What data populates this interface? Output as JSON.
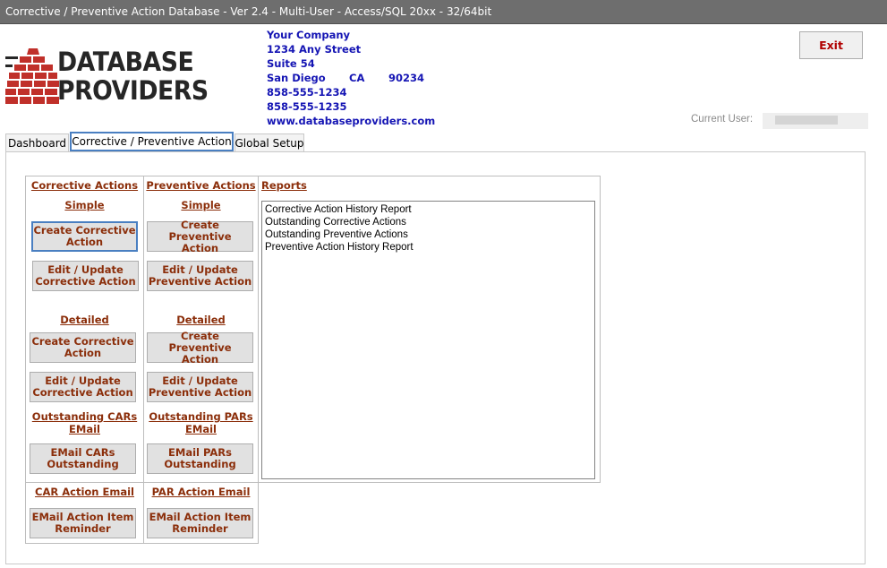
{
  "window": {
    "title": "Corrective / Preventive Action Database - Ver 2.4  - Multi-User - Access/SQL 20xx - 32/64bit"
  },
  "logo": {
    "line1": "DATABASE",
    "line2": "PROVIDERS"
  },
  "company": {
    "name": "Your Company",
    "street": "1234 Any Street",
    "suite": "Suite 54",
    "city": "San Diego",
    "state": "CA",
    "zip": "90234",
    "phone1": "858-555-1234",
    "phone2": "858-555-1235",
    "website": "www.databaseproviders.com"
  },
  "header": {
    "exit_label": "Exit",
    "current_user_label": "Current User:"
  },
  "tabs": [
    {
      "label": "Dashboard"
    },
    {
      "label": "Corrective / Preventive Action"
    },
    {
      "label": "Global Setup"
    }
  ],
  "corrective": {
    "title": "Corrective Actions",
    "simple": "Simple",
    "create_simple": "Create Corrective\nAction",
    "edit_simple": "Edit / Update\nCorrective Action",
    "detailed": "Detailed",
    "create_detailed": "Create Corrective\nAction",
    "edit_detailed": "Edit / Update\nCorrective Action",
    "outstanding_email": "Outstanding CARs\nEMail",
    "email_outstanding": "EMail CARs\nOutstanding",
    "action_email": "CAR Action Email",
    "email_reminder": "EMail Action Item\nReminder"
  },
  "preventive": {
    "title": "Preventive Actions",
    "simple": "Simple",
    "create_simple": "Create Preventive\nAction",
    "edit_simple": "Edit / Update\nPreventive Action",
    "detailed": "Detailed",
    "create_detailed": "Create Preventive\nAction",
    "edit_detailed": "Edit / Update\nPreventive Action",
    "outstanding_email": "Outstanding PARs\nEMail",
    "email_outstanding": "EMail PARs\nOutstanding",
    "action_email": "PAR Action Email",
    "email_reminder": "EMail Action Item\nReminder"
  },
  "reports": {
    "title": "Reports",
    "items": [
      "Corrective Action History Report",
      "Outstanding Corrective Actions",
      "Outstanding Preventive Actions",
      "Preventive Action History Report"
    ]
  },
  "colors": {
    "link": "#8b2e0a",
    "company_text": "#1515b4",
    "exit_text": "#b00000",
    "logo_red": "#c0302a",
    "titlebar": "#6e6e6e"
  },
  "icons": {
    "logo": "brick-wall-logo-icon"
  }
}
